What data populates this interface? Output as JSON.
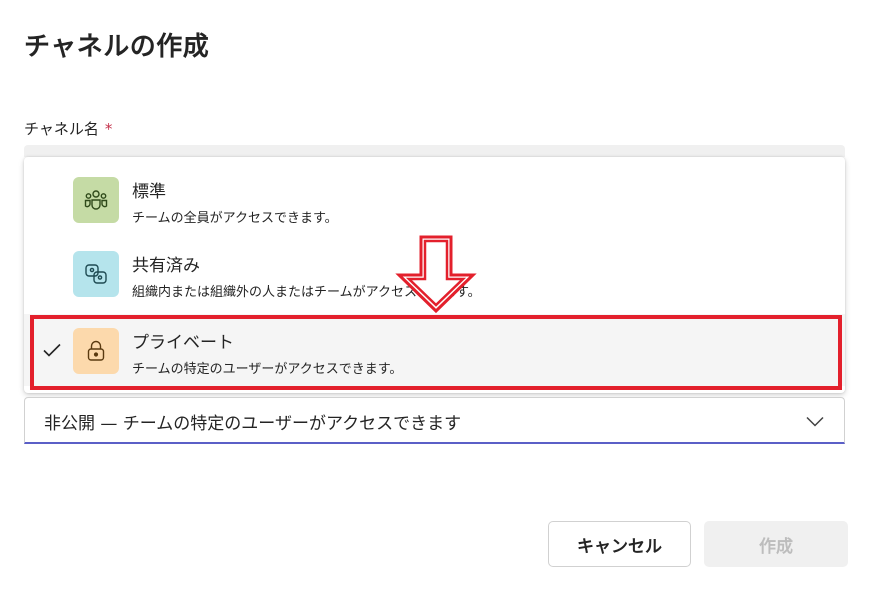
{
  "dialog": {
    "title": "チャネルの作成",
    "name_label": "チャネル名",
    "required_mark": "*"
  },
  "channel_types": [
    {
      "title": "標準",
      "description": "チームの全員がアクセスできます。",
      "icon": "people-team-icon",
      "tile_color": "#c5dba5",
      "selected": false
    },
    {
      "title": "共有済み",
      "description": "組織内または組織外の人またはチームがアクセスできます。",
      "icon": "shared-link-icon",
      "tile_color": "#b5e4ec",
      "selected": false
    },
    {
      "title": "プライベート",
      "description": "チームの特定のユーザーがアクセスできます。",
      "icon": "lock-icon",
      "tile_color": "#fcd9ac",
      "selected": true
    }
  ],
  "privacy": {
    "value": "非公開 — チームの特定のユーザーがアクセスできます"
  },
  "buttons": {
    "cancel": "キャンセル",
    "create": "作成"
  },
  "colors": {
    "accent": "#5b5fc7",
    "highlight": "#e3202c",
    "required": "#c4314b"
  }
}
